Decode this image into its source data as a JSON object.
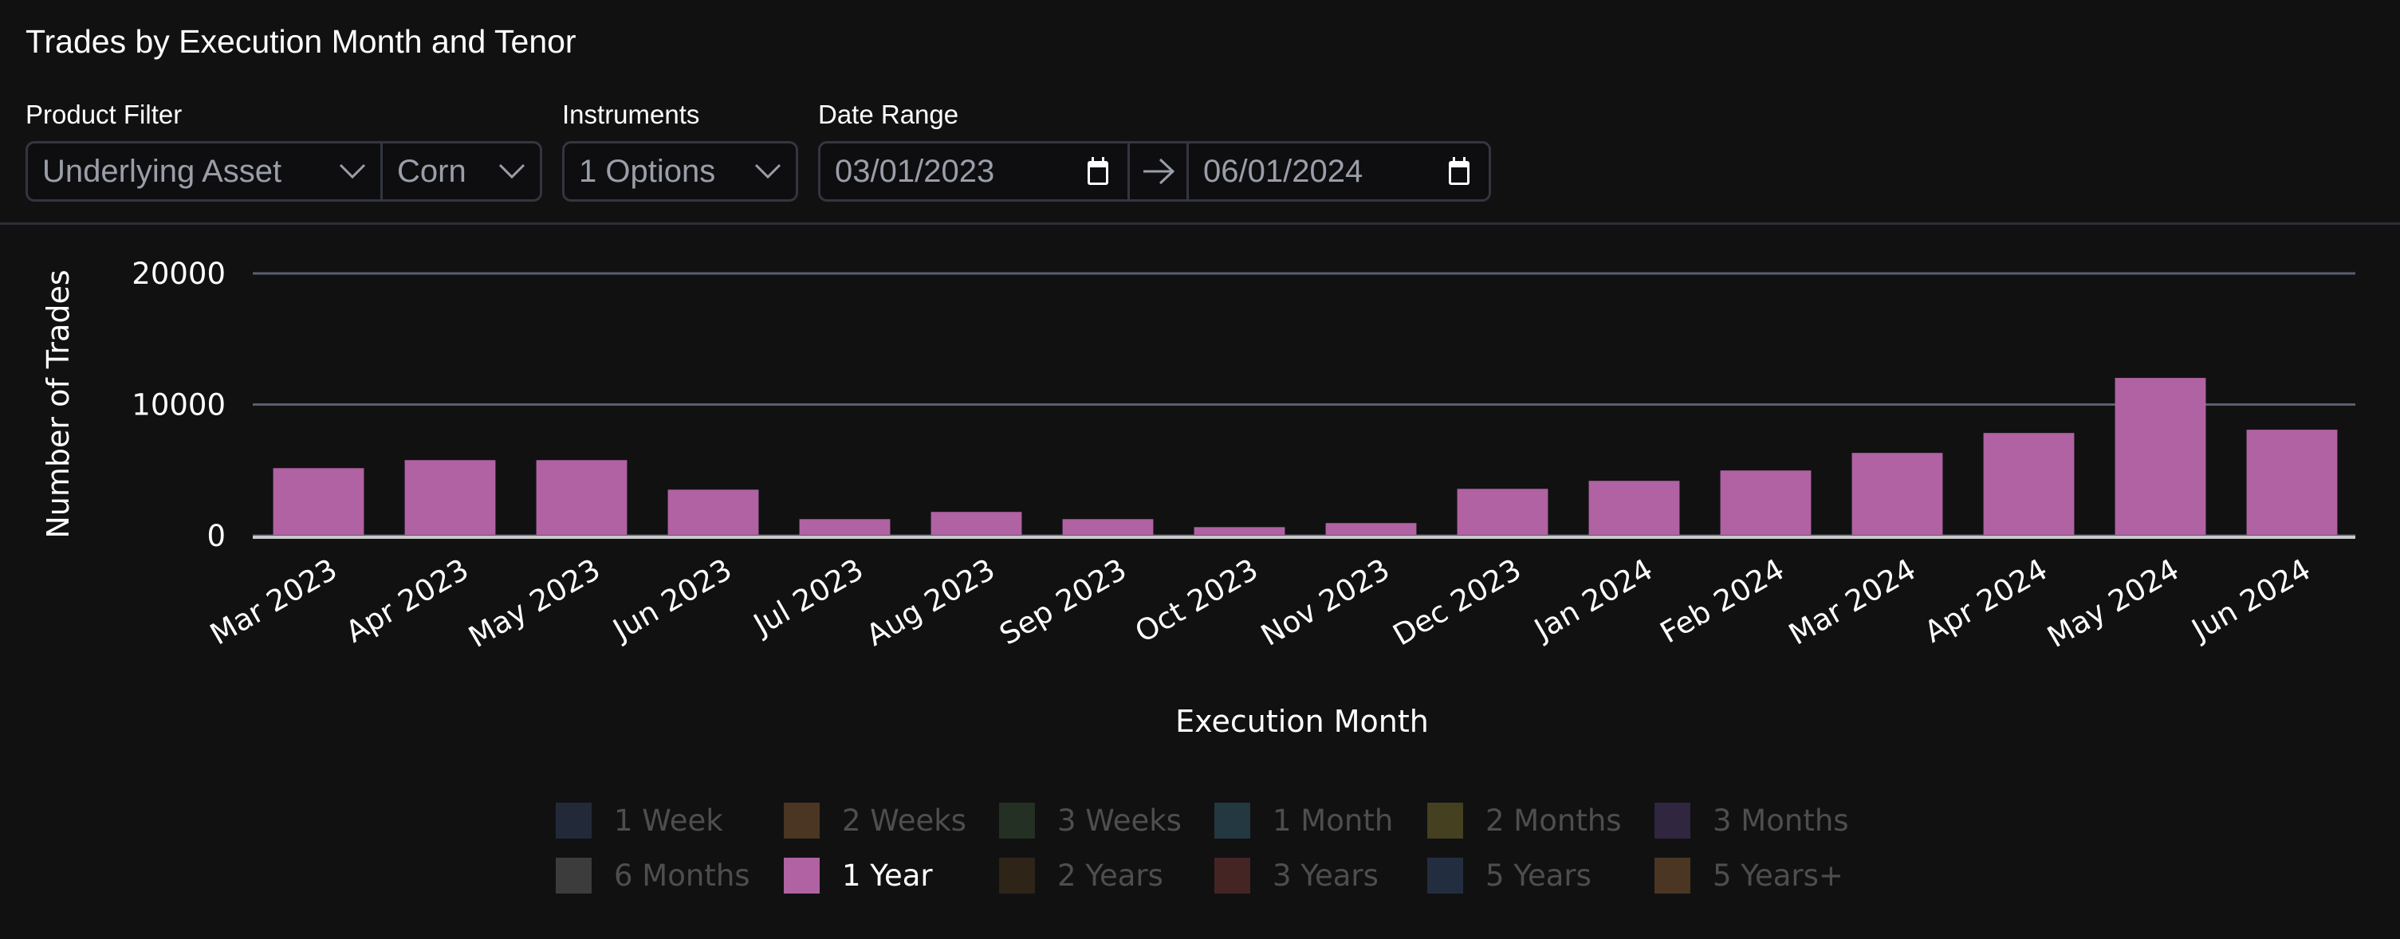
{
  "header": {
    "title": "Trades by Execution Month and Tenor"
  },
  "filters": {
    "product_filter": {
      "label": "Product Filter",
      "field": "Underlying Asset",
      "value": "Corn"
    },
    "instruments": {
      "label": "Instruments",
      "value": "1 Options"
    },
    "date_range": {
      "label": "Date Range",
      "start": "03/01/2023",
      "end": "06/01/2024",
      "separator_icon": "arrow-right-icon",
      "picker_icon": "calendar-icon"
    }
  },
  "colors": {
    "background": "#111112",
    "bar": "#b062a3",
    "gridline": "#5a5e70",
    "axis": "#c8c8c8",
    "text": "#ffffff",
    "legend_inactive_text": "#4e4e4e",
    "control_text": "#9a9ea8",
    "control_border": "#33363f"
  },
  "chart_data": {
    "type": "bar",
    "title": "Trades by Execution Month and Tenor",
    "xlabel": "Execution Month",
    "ylabel": "Number of Trades",
    "ylim": [
      0,
      20000
    ],
    "yticks": [
      0,
      10000,
      20000
    ],
    "ytick_labels": [
      "0",
      "10000",
      "20000"
    ],
    "grid": true,
    "legend_position": "bottom",
    "categories": [
      "Mar 2023",
      "Apr 2023",
      "May 2023",
      "Jun 2023",
      "Jul 2023",
      "Aug 2023",
      "Sep 2023",
      "Oct 2023",
      "Nov 2023",
      "Dec 2023",
      "Jan 2024",
      "Feb 2024",
      "Mar 2024",
      "Apr 2024",
      "May 2024",
      "Jun 2024"
    ],
    "series": [
      {
        "name": "1 Year",
        "color": "#b062a3",
        "values": [
          5150,
          5760,
          5760,
          3510,
          1260,
          1810,
          1260,
          650,
          960,
          3570,
          4180,
          4970,
          6310,
          7830,
          12030,
          8080
        ]
      }
    ],
    "legend": [
      {
        "name": "1 Week",
        "color": "#222a3a",
        "active": false
      },
      {
        "name": "2 Weeks",
        "color": "#4a3622",
        "active": false
      },
      {
        "name": "3 Weeks",
        "color": "#243024",
        "active": false
      },
      {
        "name": "1 Month",
        "color": "#233840",
        "active": false
      },
      {
        "name": "2 Months",
        "color": "#444020",
        "active": false
      },
      {
        "name": "3 Months",
        "color": "#302640",
        "active": false
      },
      {
        "name": "6 Months",
        "color": "#3c3c3c",
        "active": false
      },
      {
        "name": "1 Year",
        "color": "#b062a3",
        "active": true
      },
      {
        "name": "2 Years",
        "color": "#2e2418",
        "active": false
      },
      {
        "name": "3 Years",
        "color": "#452424",
        "active": false
      },
      {
        "name": "5 Years",
        "color": "#222e40",
        "active": false
      },
      {
        "name": "5 Years+",
        "color": "#4a3622",
        "active": false
      }
    ]
  }
}
